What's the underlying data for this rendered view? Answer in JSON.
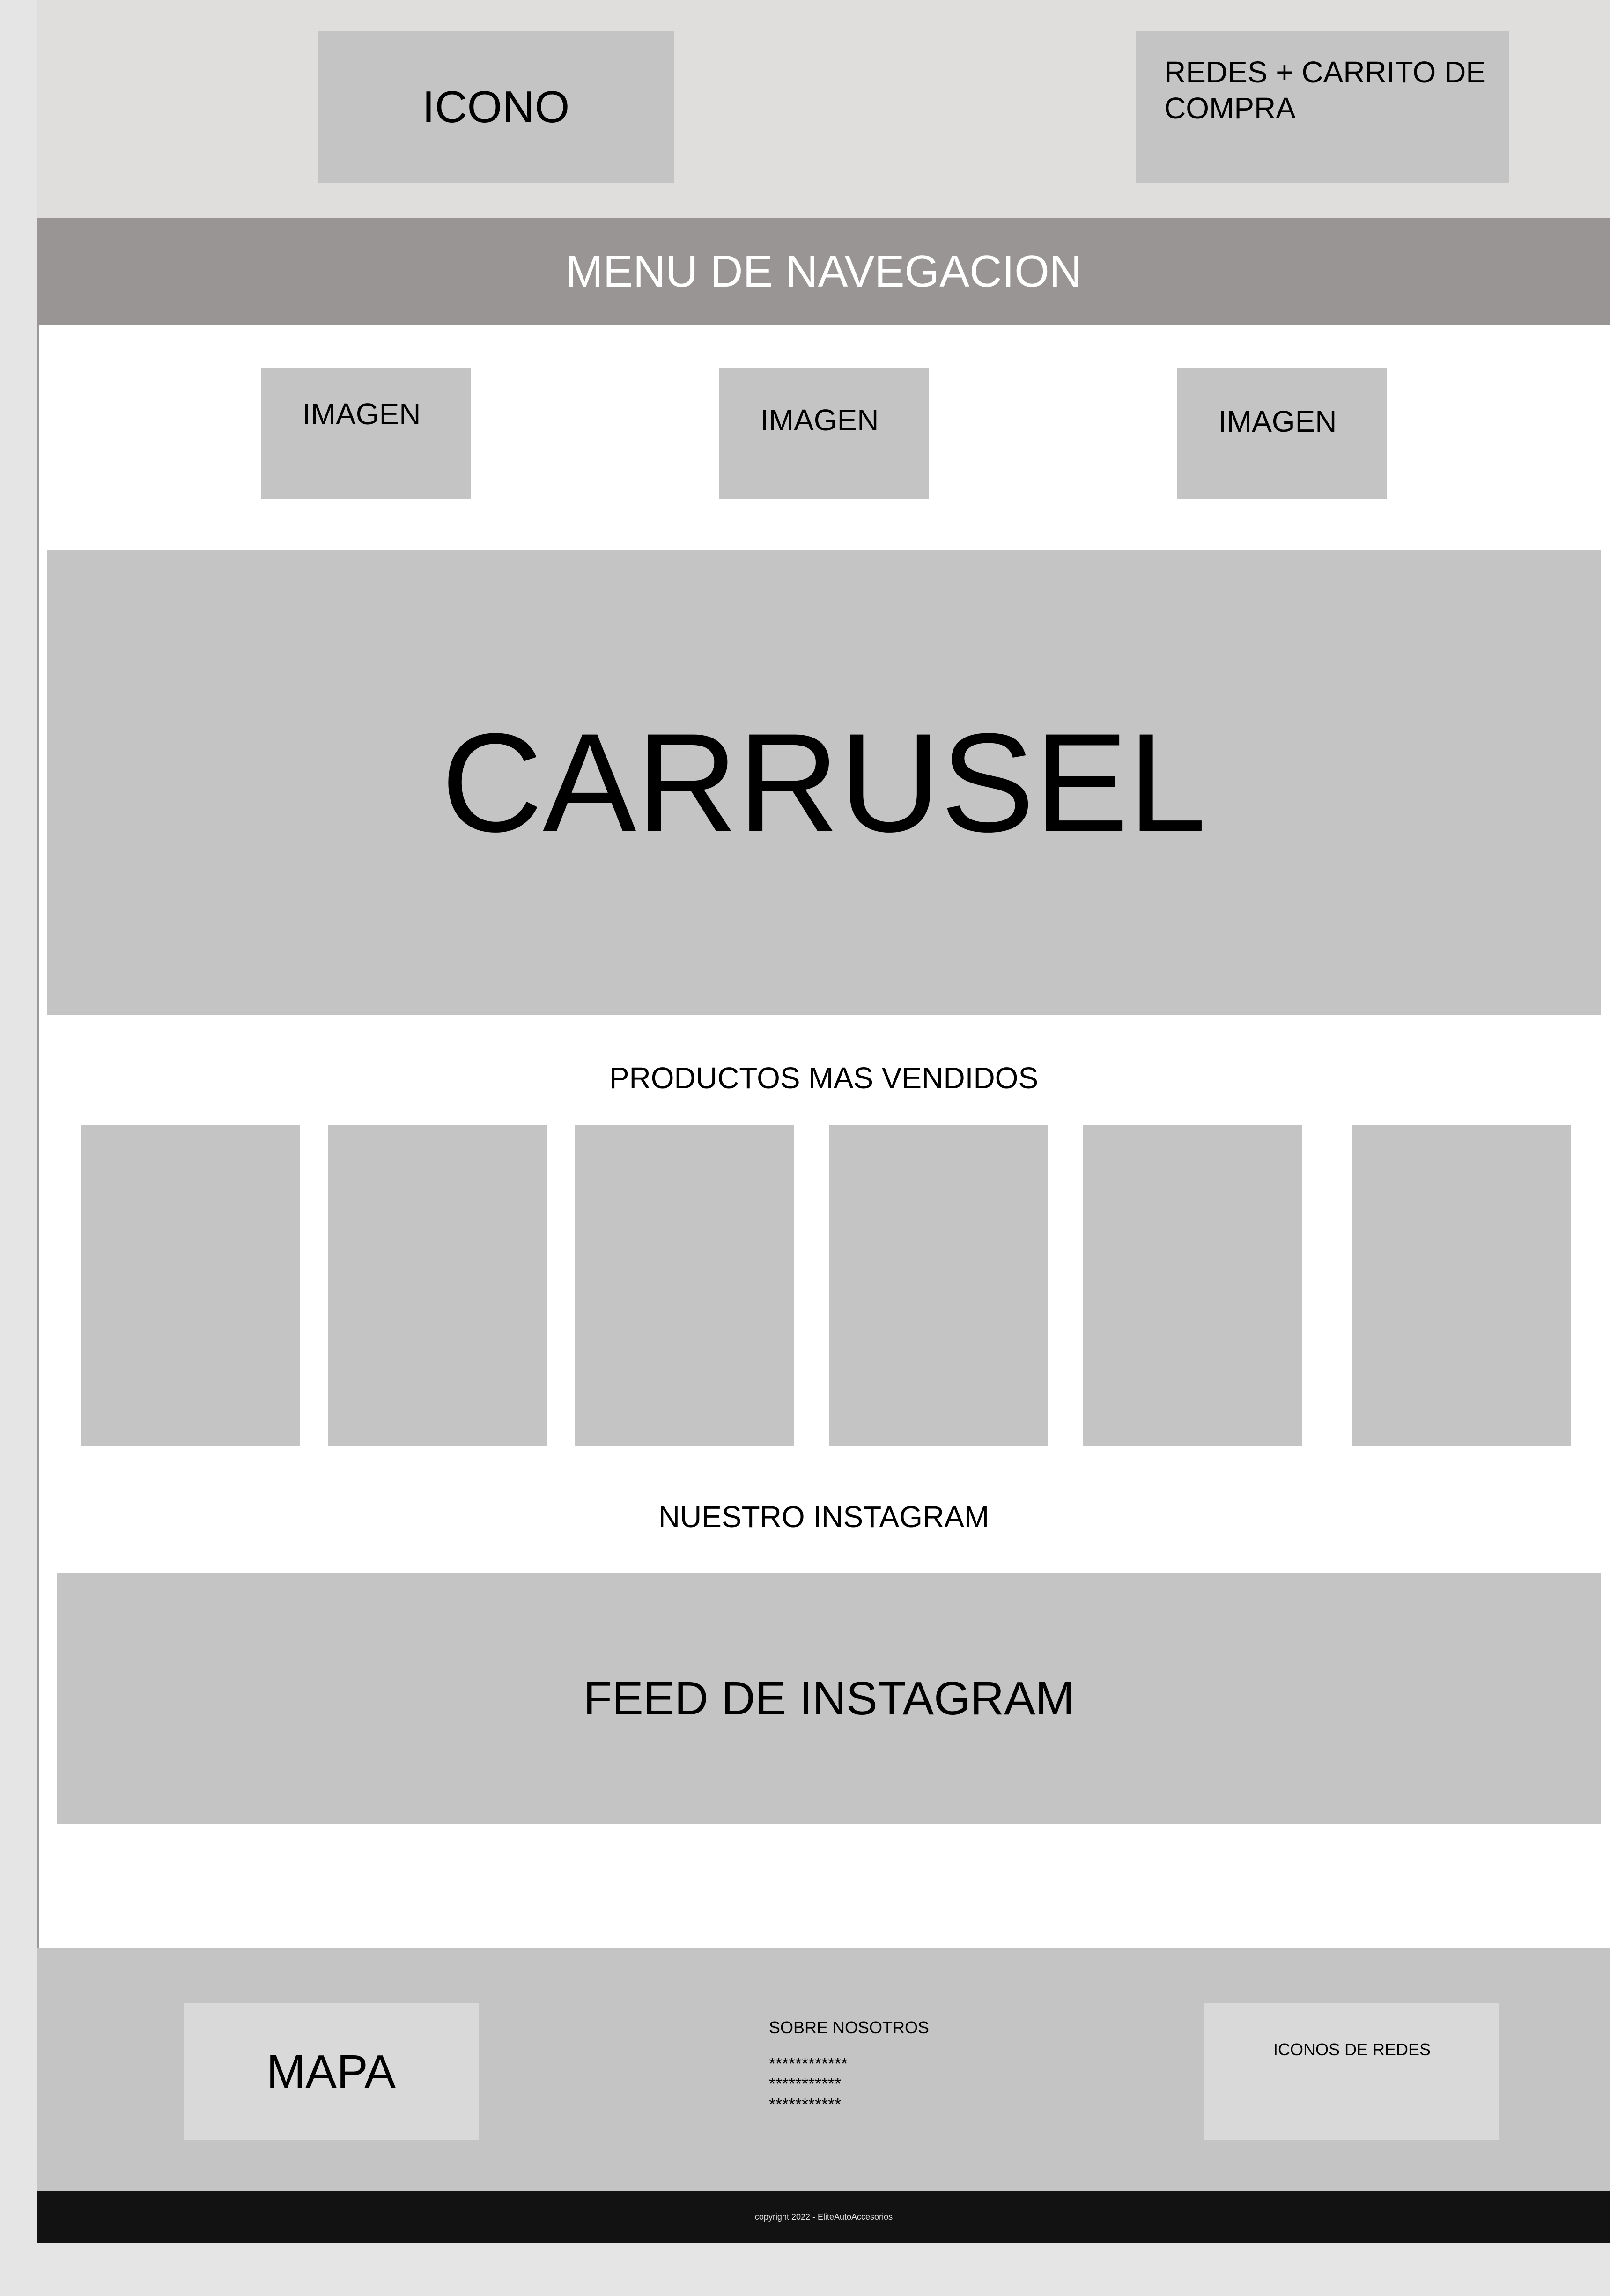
{
  "header": {
    "logo_label": "ICONO",
    "cart_label": "REDES + CARRITO DE COMPRA"
  },
  "nav": {
    "label": "MENU DE NAVEGACION"
  },
  "images": [
    {
      "label": "IMAGEN"
    },
    {
      "label": "IMAGEN"
    },
    {
      "label": "IMAGEN"
    }
  ],
  "carousel": {
    "label": "CARRUSEL"
  },
  "best_sellers": {
    "title": "PRODUCTOS MAS VENDIDOS"
  },
  "instagram": {
    "title": "NUESTRO INSTAGRAM",
    "feed_label": "FEED DE INSTAGRAM"
  },
  "footer": {
    "map_label": "MAPA",
    "about_title": "SOBRE NOSOTROS",
    "about_lines": [
      "************",
      "***********",
      "***********"
    ],
    "social_label": "ICONOS DE REDES",
    "copyright": "copyright 2022 - EliteAutoAccesorios"
  }
}
